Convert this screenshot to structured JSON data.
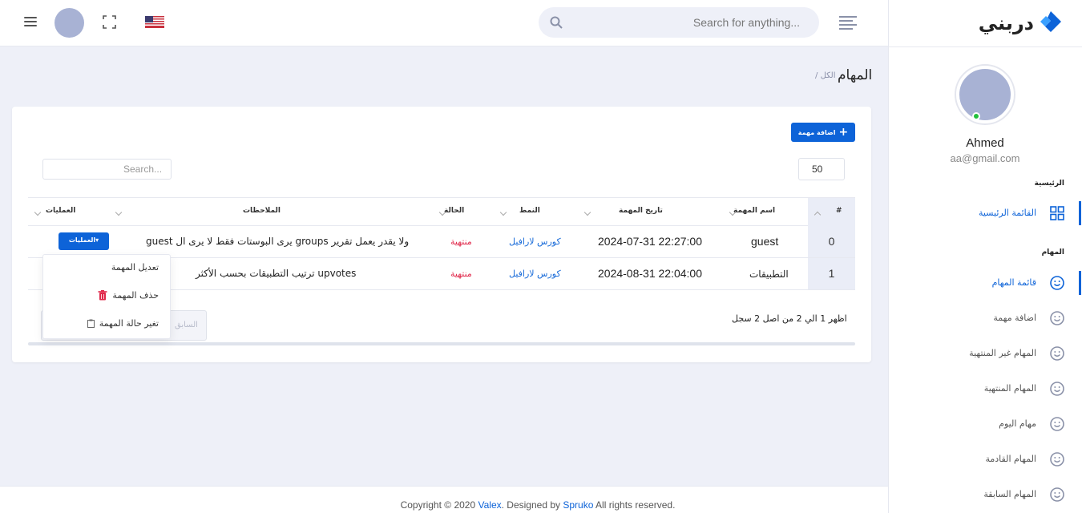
{
  "header": {
    "search_placeholder": "Search for anything...",
    "flag": "us-flag-icon"
  },
  "sidebar": {
    "logo_text": "دربني",
    "user_name": "Ahmed",
    "user_email": "aa@gmail.com",
    "sections": [
      {
        "title": "الرئيسية",
        "items": [
          {
            "label": "القائمة الرئيسية",
            "icon": "grid-icon",
            "active": true
          }
        ]
      },
      {
        "title": "المهام",
        "items": [
          {
            "label": "قائمة المهام",
            "icon": "smiley-icon",
            "active": true
          },
          {
            "label": "اضافة مهمة",
            "icon": "smiley-icon"
          },
          {
            "label": "المهام غير المنتهية",
            "icon": "smiley-icon"
          },
          {
            "label": "المهام المنتهية",
            "icon": "smiley-icon"
          },
          {
            "label": "مهام اليوم",
            "icon": "smiley-icon"
          },
          {
            "label": "المهام القادمة",
            "icon": "smiley-icon"
          },
          {
            "label": "المهام السابقة",
            "icon": "smiley-icon"
          }
        ]
      }
    ]
  },
  "breadcrumb": {
    "title": "المهام",
    "sub": "/ الكل"
  },
  "card": {
    "add_button": "اضافة مهمة",
    "page_length": "50",
    "search_placeholder": "Search...",
    "columns": [
      "#",
      "اسم المهمة",
      "تاريخ المهمة",
      "النمط",
      "الحالة",
      "الملاحظات",
      "العمليات"
    ],
    "rows": [
      {
        "num": "0",
        "name": "guest",
        "date": "2024-07-31 22:27:00",
        "type": "كورس لارافيل",
        "status": "منتهية",
        "notes": "guest يرى البوستات فقط لا يرى ال groups ولا يقدر يعمل تقرير",
        "ops": "العمليات"
      },
      {
        "num": "1",
        "name": "التطبيقات",
        "date": "2024-08-31 22:04:00",
        "type": "كورس لارافيل",
        "status": "منتهية",
        "notes": "ترتيب التطبيقات بحسب الأكثر upvotes",
        "ops": ""
      }
    ],
    "dropdown": [
      "تعديل المهمة",
      "حذف المهمة",
      "تغير حالة المهمة"
    ],
    "info": "اظهر 1 الي 2 من اصل 2 سجل",
    "prev": "السابق"
  },
  "footer": {
    "prefix": "Copyright © 2020 ",
    "brand": "Valex",
    "mid": ". Designed by ",
    "designer": "Spruko",
    "suffix": " All rights reserved."
  },
  "colors": {
    "primary": "#0d63d8",
    "danger": "#e0284a",
    "online": "#22c03c"
  }
}
